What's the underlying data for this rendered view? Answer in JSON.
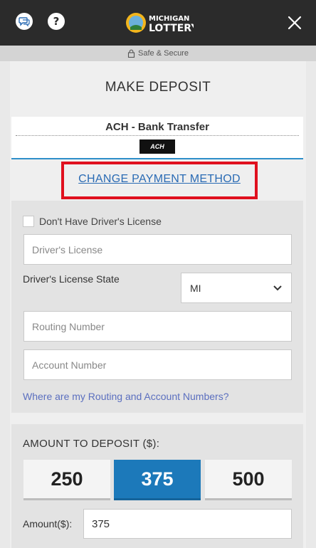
{
  "header": {
    "logo_line1": "MICHIGAN",
    "logo_line2": "LOTTERY",
    "help_label": "?",
    "secure_text": "Safe & Secure"
  },
  "page": {
    "title": "MAKE DEPOSIT"
  },
  "payment_method": {
    "name": "ACH - Bank Transfer",
    "badge_text": "ACH",
    "change_link": "CHANGE PAYMENT METHOD"
  },
  "form": {
    "no_license_label": "Don't Have Driver's License",
    "no_license_checked": false,
    "drivers_license_placeholder": "Driver's License",
    "state_label": "Driver's License State",
    "state_value": "MI",
    "routing_placeholder": "Routing Number",
    "account_placeholder": "Account Number",
    "help_link": "Where are my Routing and Account Numbers?"
  },
  "amount": {
    "label": "AMOUNT TO DEPOSIT ($):",
    "options": [
      "250",
      "375",
      "500"
    ],
    "selected": "375",
    "input_label": "Amount($):",
    "input_value": "375"
  },
  "colors": {
    "accent": "#1c79ba",
    "highlight": "#e0101e",
    "link": "#2a6bb4",
    "topbar": "#2b2b2b"
  }
}
